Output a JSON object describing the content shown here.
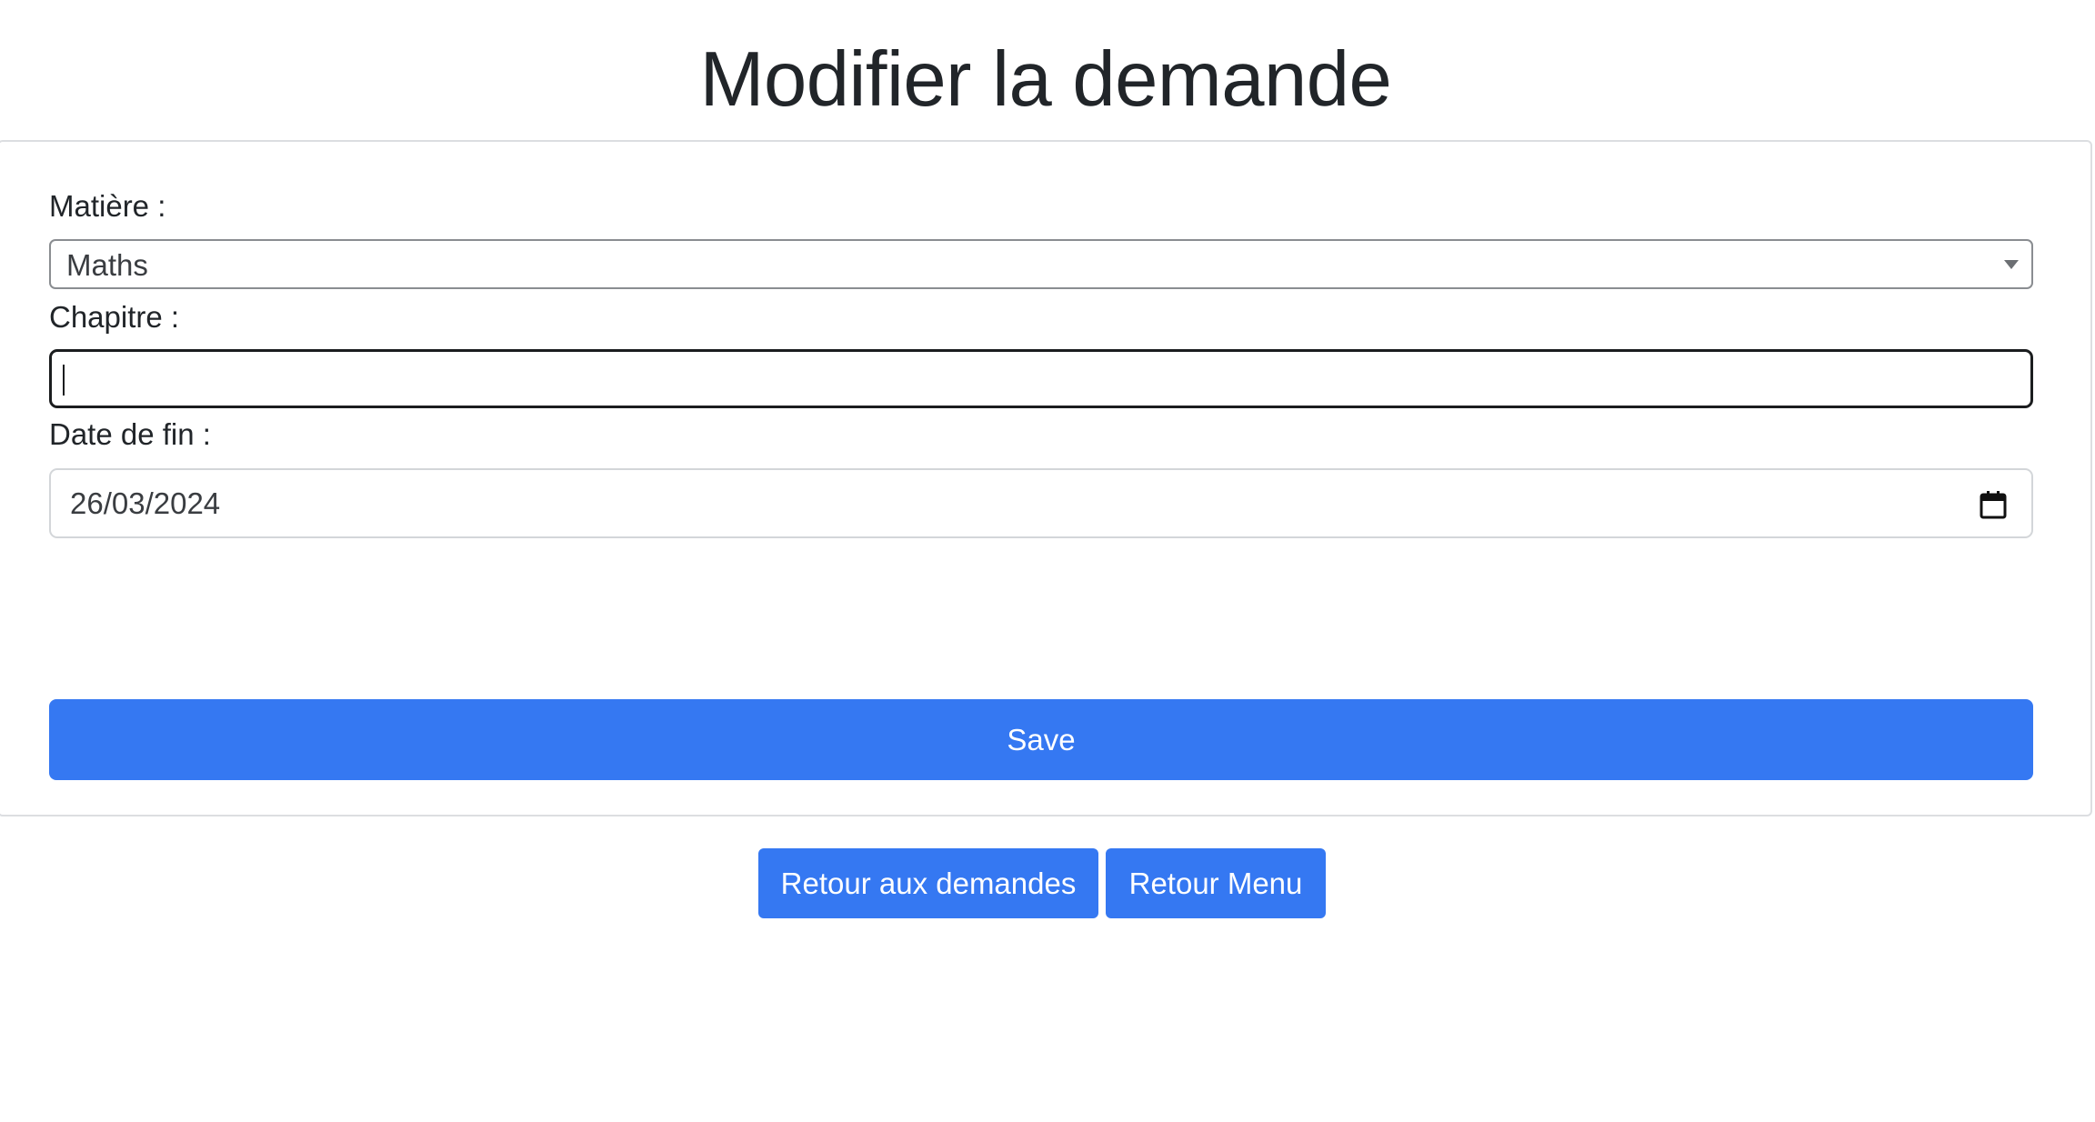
{
  "page": {
    "title": "Modifier la demande"
  },
  "form": {
    "matiere": {
      "label": "Matière :",
      "selected": "Maths"
    },
    "chapitre": {
      "label": "Chapitre :",
      "value": ""
    },
    "date_fin": {
      "label": "Date de fin :",
      "value": "26/03/2024"
    },
    "save_label": "Save"
  },
  "nav": {
    "retour_demandes": "Retour aux demandes",
    "retour_menu": "Retour Menu"
  },
  "colors": {
    "primary": "#3578f2",
    "text": "#212529",
    "border": "#dcdee1"
  },
  "icons": {
    "select_arrow": "chevron-down-icon",
    "date_picker": "calendar-icon"
  }
}
